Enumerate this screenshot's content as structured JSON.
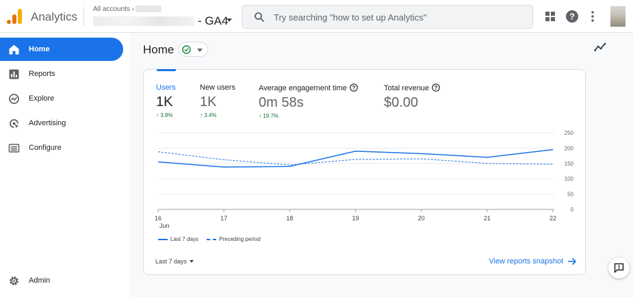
{
  "header": {
    "app_name": "Analytics",
    "breadcrumb": "All accounts",
    "property_name": "- GA4",
    "search_placeholder": "Try searching \"how to set up Analytics\""
  },
  "icons": {
    "logo": "analytics-logo",
    "search": "search-icon",
    "apps": "apps-grid-icon",
    "help": "help-icon",
    "more": "more-vert-icon"
  },
  "sidebar": {
    "items": [
      {
        "label": "Home",
        "icon": "home-icon",
        "active": true
      },
      {
        "label": "Reports",
        "icon": "reports-icon"
      },
      {
        "label": "Explore",
        "icon": "explore-icon"
      },
      {
        "label": "Advertising",
        "icon": "advertising-icon"
      },
      {
        "label": "Configure",
        "icon": "configure-icon"
      }
    ],
    "admin": {
      "label": "Admin",
      "icon": "gear-icon"
    }
  },
  "main": {
    "title": "Home"
  },
  "card": {
    "metrics": [
      {
        "label": "Users",
        "value": "1K",
        "change": "3.8%"
      },
      {
        "label": "New users",
        "value": "1K",
        "change": "3.4%"
      },
      {
        "label": "Average engagement time",
        "value": "0m 58s",
        "change": "19.7%"
      },
      {
        "label": "Total revenue",
        "value": "$0.00",
        "change": ""
      }
    ],
    "legend": {
      "current": "Last 7 days",
      "previous": "Preceding period"
    },
    "date_range": "Last 7 days",
    "snapshot_link": "View reports snapshot"
  },
  "colors": {
    "accent": "#1a73e8",
    "positive": "#137333"
  },
  "chart_data": {
    "type": "line",
    "x": [
      "16",
      "17",
      "18",
      "19",
      "20",
      "21",
      "22"
    ],
    "x_sublabel": "Jun",
    "y_ticks": [
      0,
      50,
      100,
      150,
      200,
      250
    ],
    "ylim": [
      0,
      250
    ],
    "grid": true,
    "series": [
      {
        "name": "Last 7 days",
        "style": "solid",
        "values": [
          155,
          138,
          140,
          190,
          182,
          170,
          195
        ]
      },
      {
        "name": "Preceding period",
        "style": "dashed",
        "values": [
          188,
          162,
          145,
          163,
          165,
          150,
          147
        ]
      }
    ]
  }
}
